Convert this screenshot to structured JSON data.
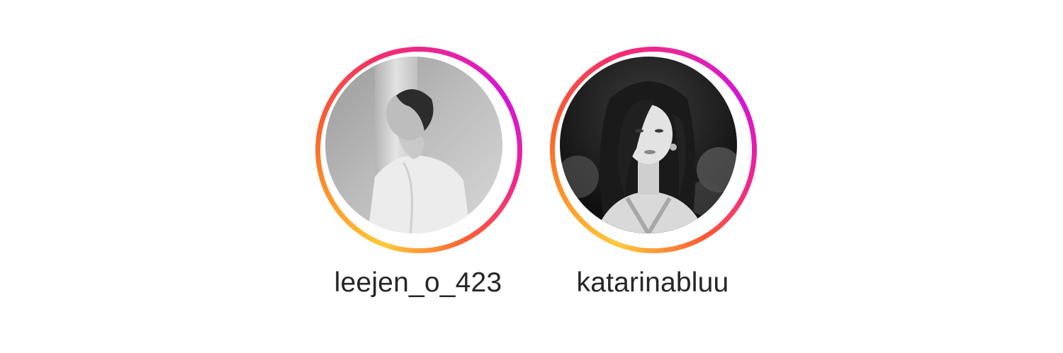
{
  "stories": [
    {
      "username": "leejen_o_423",
      "avatar_icon": "profile-photo-grayscale-man"
    },
    {
      "username": "katarinabluu",
      "avatar_icon": "profile-photo-grayscale-woman"
    }
  ],
  "colors": {
    "ring_gradient": [
      "#fec93a",
      "#fd9a2a",
      "#f9652b",
      "#f42b6d",
      "#e523a8",
      "#d514d6"
    ],
    "text": "#262626",
    "background": "#ffffff"
  }
}
